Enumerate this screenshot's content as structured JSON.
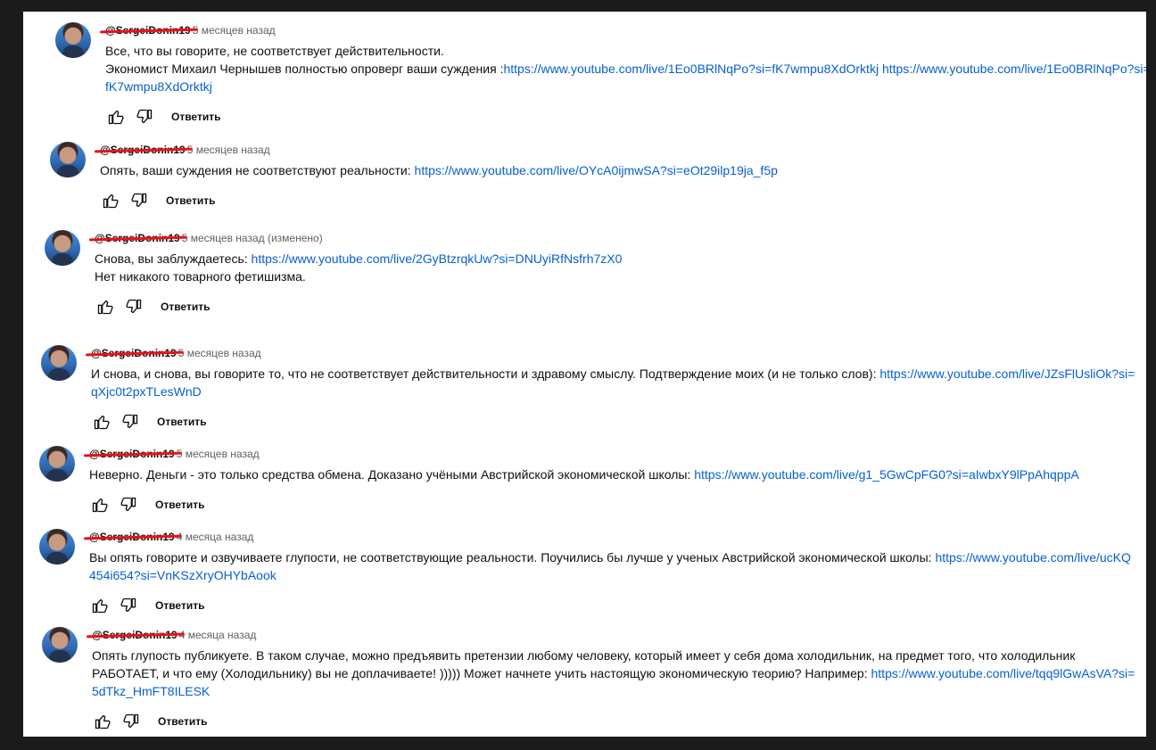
{
  "reply_label": "Ответить",
  "comments": [
    {
      "author": "@SergeiDonin19",
      "time": "5 месяцев назад",
      "lines": [
        {
          "text": "Все, что вы говорите, не соответствует действительности.",
          "links": []
        },
        {
          "text": "Экономист Михаил Чернышев полностью опроверг ваши суждения :",
          "links": [
            "https://www.youtube.com/live/1Eo0BRlNqPo?si=fK7wmpu8XdOrktkj",
            "https://www.youtube.com/live/1Eo0BRlNqPo?si=fK7wmpu8XdOrktkj"
          ]
        }
      ]
    },
    {
      "author": "@SergeiDonin19",
      "time": "5 месяцев назад",
      "lines": [
        {
          "text": "Опять, ваши суждения не соответствуют реальности: ",
          "links": [
            "https://www.youtube.com/live/OYcA0ijmwSA?si=eOt29ilp19ja_f5p"
          ]
        }
      ]
    },
    {
      "author": "@SergeiDonin19",
      "time": "5 месяцев назад (изменено)",
      "lines": [
        {
          "text": "Снова, вы заблуждаетесь: ",
          "links": [
            "https://www.youtube.com/live/2GyBtzrqkUw?si=DNUyiRfNsfrh7zX0"
          ]
        },
        {
          "text": "Нет никакого товарного фетишизма.",
          "links": []
        }
      ]
    },
    {
      "author": "@SergeiDonin19",
      "time": "5 месяцев назад",
      "lines": [
        {
          "text": "И снова, и снова, вы говорите то, что не соответствует действительности и здравому смыслу. Подтверждение моих (и не только слов): ",
          "links": [
            "https://www.youtube.com/live/JZsFlUsliOk?si=qXjc0t2pxTLesWnD"
          ]
        }
      ]
    },
    {
      "author": "@SergeiDonin19",
      "time": "5 месяцев назад",
      "lines": [
        {
          "text": "Неверно. Деньги - это только средства обмена. Доказано учёными Австрийской экономической школы: ",
          "links": [
            "https://www.youtube.com/live/g1_5GwCpFG0?si=aIwbxY9lPpAhqppA"
          ]
        }
      ]
    },
    {
      "author": "@SergeiDonin19",
      "time": "4 месяца назад",
      "lines": [
        {
          "text": "Вы опять говорите и озвучиваете глупости, не соответствующие реальности. Поучились бы лучше у ученых Австрийской экономической школы: ",
          "links": [
            "https://www.youtube.com/live/ucKQ454i654?si=VnKSzXryOHYbAook"
          ]
        }
      ]
    },
    {
      "author": "@SergeiDonin19",
      "time": "4 месяца назад",
      "lines": [
        {
          "text": "Опять глупость публикуете. В таком случае, можно предъявить претензии любому человеку, который имеет у себя дома холодильник, на предмет того, что холодильник РАБОТАЕТ, и что ему (Холодильнику) вы не доплачиваете! ))))) Может начнете учить настоящую экономическую теорию? Например: ",
          "links": [
            "https://www.youtube.com/live/tqq9lGwAsVA?si=5dTkz_HmFT8ILESK"
          ]
        }
      ]
    }
  ]
}
